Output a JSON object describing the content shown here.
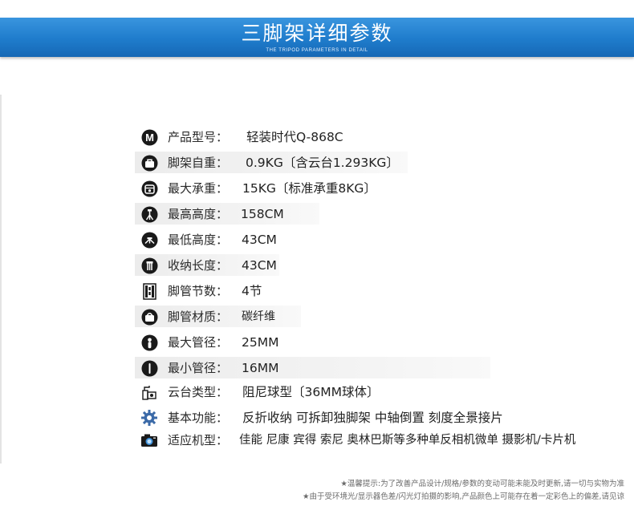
{
  "banner": {
    "title": "三脚架详细参数",
    "subtitle": "THE TRIPOD PARAMETERS IN DETAIL",
    "colors": {
      "top": "#3a95de",
      "bottom": "#1668b5"
    }
  },
  "specs": [
    {
      "icon": "m-letter-icon",
      "label": "产品型号：",
      "value": "轻装时代Q-868C"
    },
    {
      "icon": "bag-icon",
      "label": "脚架自重：",
      "value": "0.9KG〔含云台1.293KG〕"
    },
    {
      "icon": "scale-icon",
      "label": "最大承重：",
      "value": "15KG〔标准承重8KG〕"
    },
    {
      "icon": "tripod-tall-icon",
      "label": "最高高度：",
      "value": "158CM"
    },
    {
      "icon": "tripod-low-icon",
      "label": "最低高度：",
      "value": "43CM"
    },
    {
      "icon": "folded-tripod-icon",
      "label": "收纳长度：",
      "value": "43CM"
    },
    {
      "icon": "sections-icon",
      "label": "脚管节数：",
      "value": "4节"
    },
    {
      "icon": "material-bag-icon",
      "label": "脚管材质：",
      "value": "碳纤维"
    },
    {
      "icon": "tube-large-icon",
      "label": "最大管径：",
      "value": "25MM"
    },
    {
      "icon": "tube-small-icon",
      "label": "最小管径：",
      "value": "16MM"
    },
    {
      "icon": "tripod-head-icon",
      "label": "云台类型：",
      "value": "阻尼球型〔36MM球体〕"
    },
    {
      "icon": "gear-icon",
      "label": "基本功能：",
      "value": "反折收纳  可拆卸独脚架  中轴倒置  刻度全景接片"
    },
    {
      "icon": "camera-icon",
      "label": "适应机型：",
      "value": "佳能 尼康  宾得  索尼  奥林巴斯等多种单反相机微单  摄影机/卡片机"
    }
  ],
  "footer": {
    "line1": "★温馨提示:为了改善产品设计/规格/参数的变动可能未能及时更新,请一切与实物为准",
    "line2": "★由于受环境光/显示器色差/闪光灯拍摄的影响,产品颜色上可能存在着一定彩色上的偏差,请见谅"
  }
}
